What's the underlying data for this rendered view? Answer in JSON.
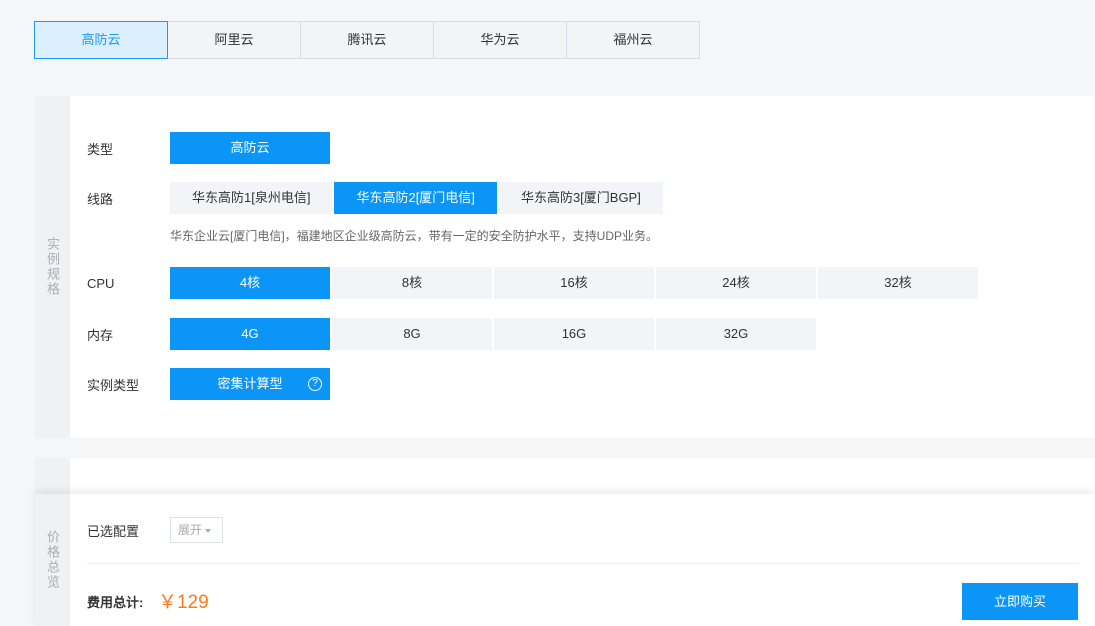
{
  "tabs": [
    "高防云",
    "阿里云",
    "腾讯云",
    "华为云",
    "福州云"
  ],
  "spec_section": {
    "side_label": "实例规格",
    "type": {
      "label": "类型",
      "options": [
        "高防云"
      ]
    },
    "line": {
      "label": "线路",
      "options": [
        "华东高防1[泉州电信]",
        "华东高防2[厦门电信]",
        "华东高防3[厦门BGP]"
      ],
      "hint": "华东企业云[厦门电信]，福建地区企业级高防云，带有一定的安全防护水平，支持UDP业务。"
    },
    "cpu": {
      "label": "CPU",
      "options": [
        "4核",
        "8核",
        "16核",
        "24核",
        "32核"
      ]
    },
    "memory": {
      "label": "内存",
      "options": [
        "4G",
        "8G",
        "16G",
        "32G"
      ]
    },
    "instance_type": {
      "label": "实例类型",
      "value": "密集计算型",
      "help": "?"
    }
  },
  "summary": {
    "side_label": "价格总览",
    "selected_config_label": "已选配置",
    "expand_label": "展开",
    "total_label": "费用总计:",
    "price": "￥129",
    "buy_label": "立即购买"
  },
  "colors": {
    "accent": "#0b95f6",
    "price": "#ff7a1a"
  }
}
